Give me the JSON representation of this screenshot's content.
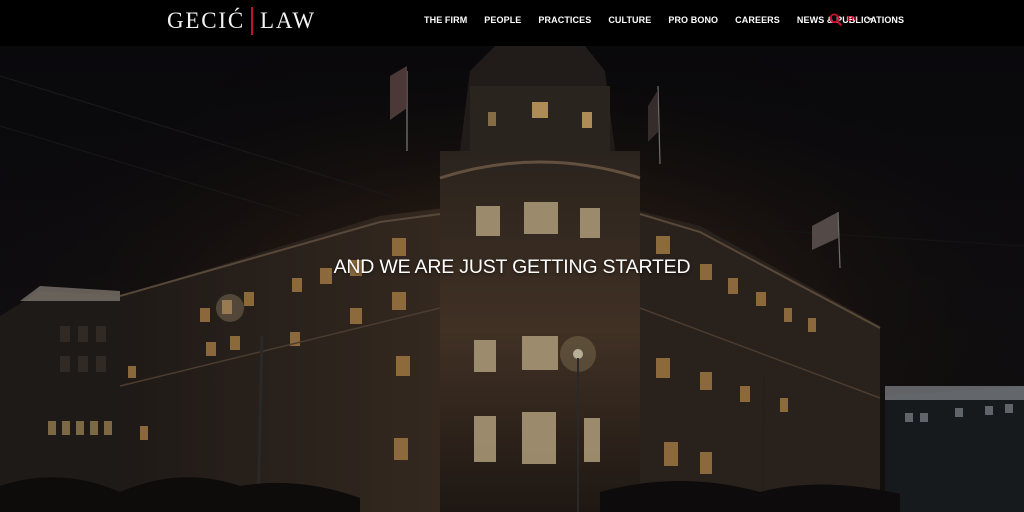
{
  "brand": {
    "left": "GECIĆ",
    "right": "LAW",
    "accent_color": "#c8102e"
  },
  "nav": {
    "items": [
      "THE FIRM",
      "PEOPLE",
      "PRACTICES",
      "CULTURE",
      "PRO BONO",
      "CAREERS",
      "NEWS & PUBLICATIONS"
    ]
  },
  "search": {
    "icon": "search-icon"
  },
  "language": {
    "current": "EN",
    "icon": "caret-down-icon"
  },
  "hero": {
    "headline": "AND WE ARE JUST GETTING STARTED",
    "image": "night-building-photo"
  }
}
